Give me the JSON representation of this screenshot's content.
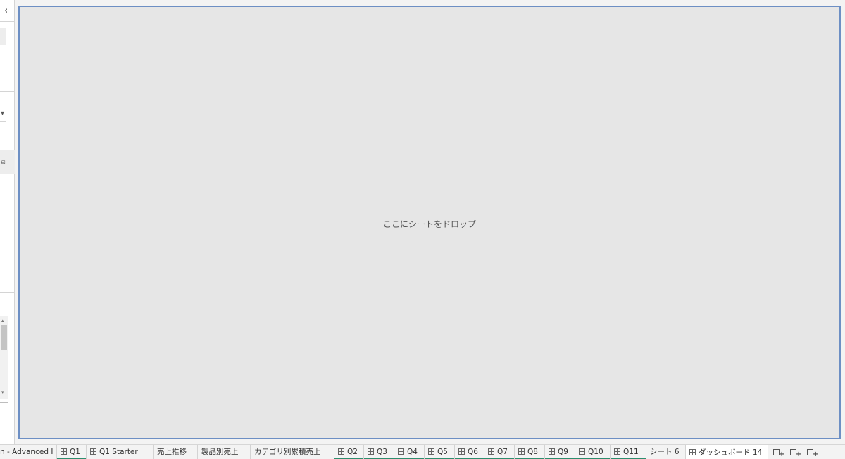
{
  "drop_zone": {
    "text": "ここにシートをドロップ"
  },
  "left_panel": {
    "collapse_glyph": "‹",
    "dropdown_glyph": "▾",
    "popout_glyph": "⧉",
    "scroll_up_glyph": "▴",
    "scroll_down_glyph": "▾"
  },
  "tabs": [
    {
      "label": "n - Advanced I"
    },
    {
      "label": "Q1"
    },
    {
      "label": "Q1 Starter"
    },
    {
      "label": "売上推移"
    },
    {
      "label": "製品別売上"
    },
    {
      "label": "カテゴリ別累積売上"
    },
    {
      "label": "Q2"
    },
    {
      "label": "Q3"
    },
    {
      "label": "Q4"
    },
    {
      "label": "Q5"
    },
    {
      "label": "Q6"
    },
    {
      "label": "Q7"
    },
    {
      "label": "Q8"
    },
    {
      "label": "Q9"
    },
    {
      "label": "Q10"
    },
    {
      "label": "Q11"
    },
    {
      "label": "シート 6"
    },
    {
      "label": "ダッシュボード 14"
    }
  ],
  "tab_strip_buttons": [
    {
      "icon": "new-worksheet-icon"
    },
    {
      "icon": "new-dashboard-icon"
    },
    {
      "icon": "new-story-icon"
    }
  ],
  "colors": {
    "drop_border": "#6d8fc4",
    "drop_bg": "#e6e6e6",
    "tab_underline": "#2d8f6f"
  }
}
